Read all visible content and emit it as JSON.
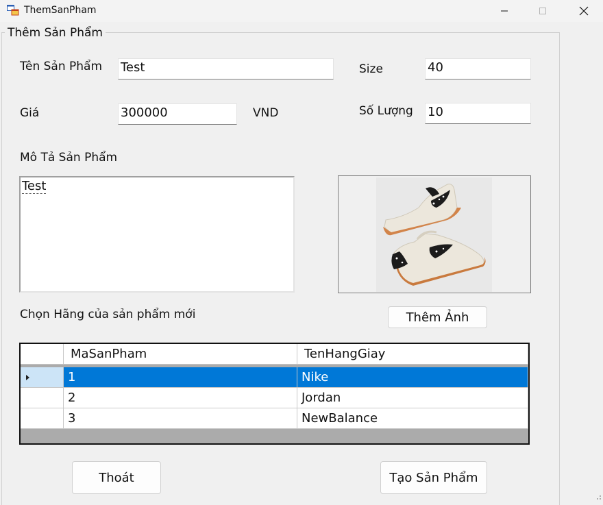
{
  "window": {
    "title": "ThemSanPham"
  },
  "group": {
    "title": "Thêm Sản Phẩm"
  },
  "form": {
    "name_label": "Tên Sản Phẩm",
    "name_value": "Test",
    "size_label": "Size",
    "size_value": "40",
    "price_label": "Giá",
    "price_value": "300000",
    "currency": "VND",
    "qty_label": "Số Lượng",
    "qty_value": "10",
    "desc_label": "Mô Tả Sản Phẩm",
    "desc_value": "Test",
    "brand_label": "Chọn Hãng của sản phẩm mới"
  },
  "buttons": {
    "add_image": "Thêm Ảnh",
    "exit": "Thoát",
    "create": "Tạo Sản Phẩm"
  },
  "grid": {
    "columns": [
      "MaSanPham",
      "TenHangGiay"
    ],
    "rows": [
      {
        "id": "1",
        "name": "Nike",
        "selected": true
      },
      {
        "id": "2",
        "name": "Jordan",
        "selected": false
      },
      {
        "id": "3",
        "name": "NewBalance",
        "selected": false
      }
    ]
  },
  "icons": {
    "app": "app-window-icon",
    "minimize": "minimize-icon",
    "maximize": "maximize-icon",
    "close": "close-icon",
    "row_pointer": "row-pointer-icon"
  },
  "colors": {
    "selection": "#0078d7",
    "row_header_selected": "#cce4f7",
    "grid_background": "#ababab"
  }
}
